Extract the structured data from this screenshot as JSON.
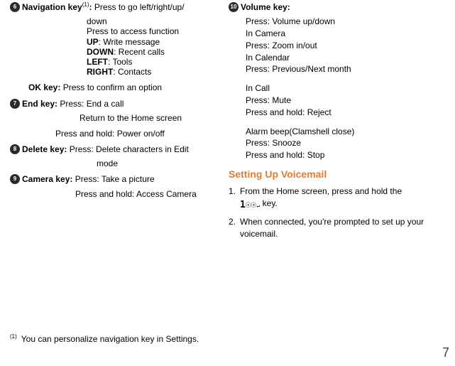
{
  "col1": {
    "nav": {
      "num": "6",
      "label": "Navigation key",
      "sup": "(1)",
      "l1": "Press to go left/right/up/",
      "l1b": "down",
      "l2": "Press to access function",
      "up_k": "UP",
      "up_v": ": Write message",
      "down_k": "DOWN",
      "down_v": ": Recent calls",
      "left_k": "LEFT",
      "left_v": ": Tools",
      "right_k": "RIGHT",
      "right_v": ": Contacts"
    },
    "ok": {
      "label": "OK key:",
      "desc": "Press to confirm an option"
    },
    "end": {
      "num": "7",
      "label": "End key:",
      "l1": "Press: End a call",
      "l2": "Return to the Home screen",
      "l3": "Press and hold: Power on/off"
    },
    "del": {
      "num": "8",
      "label": "Delete key:",
      "l1": "Press: Delete characters in Edit",
      "l2": "mode"
    },
    "cam": {
      "num": "9",
      "label": "Camera key:",
      "l1": "Press: Take a picture",
      "l2": "Press and hold: Access Camera"
    }
  },
  "col2": {
    "vol": {
      "num": "10",
      "label": "Volume key:",
      "b1a": "Press: Volume up/down",
      "b1b": "In Camera",
      "b1c": "Press: Zoom in/out",
      "b1d": "In Calendar",
      "b1e": "Press: Previous/Next month",
      "b2a": "In Call",
      "b2b": "Press: Mute",
      "b2c": "Press and hold: Reject",
      "b3a": "Alarm beep(Clamshell close)",
      "b3b": "Press: Snooze",
      "b3c": "Press and hold: Stop"
    },
    "voicemail": {
      "title": "Setting Up Voicemail",
      "s1a": "From the Home screen, press and hold the",
      "s1b_icon": "1",
      "s1b_tail": " key.",
      "s2": "When connected, you're prompted to set up your voicemail."
    }
  },
  "footnote": {
    "mark": "(1)",
    "text": "You can personalize navigation key in Settings."
  },
  "pagenum": "7"
}
